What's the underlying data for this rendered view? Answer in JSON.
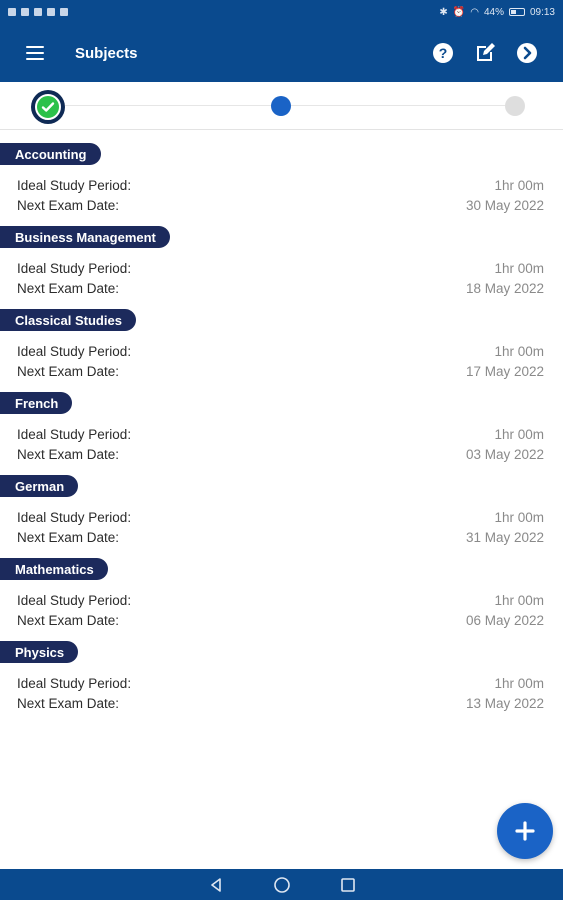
{
  "status_bar": {
    "battery": "44%",
    "time": "09:13",
    "battery_level": 0.44
  },
  "app_bar": {
    "title": "Subjects",
    "icons": [
      "menu-icon",
      "help-icon",
      "edit-icon",
      "next-icon"
    ]
  },
  "stepper": {
    "steps": [
      "completed",
      "current",
      "upcoming"
    ]
  },
  "labels": {
    "study_period": "Ideal Study Period:",
    "exam_date": "Next Exam Date:"
  },
  "subjects": [
    {
      "name": "Accounting",
      "study_period": "1hr 00m",
      "exam_date": "30 May 2022"
    },
    {
      "name": "Business Management",
      "study_period": "1hr 00m",
      "exam_date": "18 May 2022"
    },
    {
      "name": "Classical Studies",
      "study_period": "1hr 00m",
      "exam_date": "17 May 2022"
    },
    {
      "name": "French",
      "study_period": "1hr 00m",
      "exam_date": "03 May 2022"
    },
    {
      "name": "German",
      "study_period": "1hr 00m",
      "exam_date": "31 May 2022"
    },
    {
      "name": "Mathematics",
      "study_period": "1hr 00m",
      "exam_date": "06 May 2022"
    },
    {
      "name": "Physics",
      "study_period": "1hr 00m",
      "exam_date": "13 May 2022"
    }
  ],
  "colors": {
    "primary": "#0a4a8e",
    "pill": "#1c2a5c",
    "accent": "#1a63c6",
    "success": "#2cc14a"
  }
}
